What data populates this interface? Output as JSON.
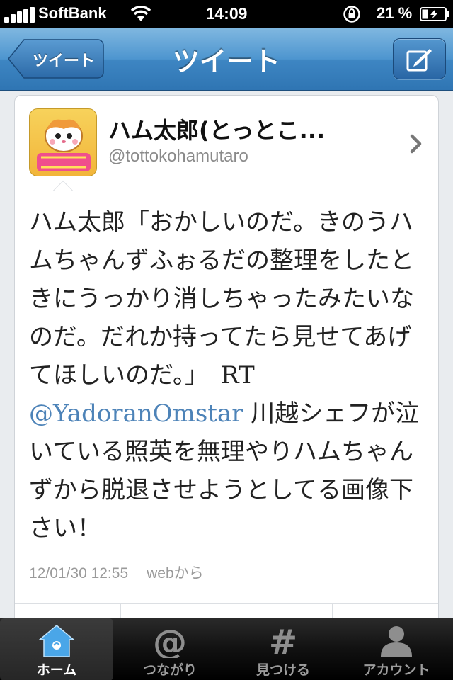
{
  "status_bar": {
    "carrier": "SoftBank",
    "time": "14:09",
    "battery_percent": "21 %"
  },
  "nav": {
    "back_label": "ツイート",
    "title": "ツイート",
    "compose_icon": "compose-icon"
  },
  "tweet": {
    "display_name": "ハム太郎(とっとこ...",
    "username": "@tottokohamutaro",
    "text_part1": "ハム太郎「おかしいのだ。きのうハムちゃんずふぉるだの整理をしたときにうっかり消しちゃったみたいなのだ。だれか持ってたら見せてあげてほしいのだ。」　",
    "rt": "RT",
    "mention": "@YadoranOmstar",
    "text_part2": " 川越シェフが泣いている照英を無理やりハムちゃんずから脱退させようとしてる画像下さい！",
    "timestamp": "12/01/30 12:55",
    "source": "webから"
  },
  "tab_bar": {
    "tabs": [
      {
        "label": "ホーム",
        "icon": "home-icon",
        "active": true
      },
      {
        "label": "つながり",
        "icon": "at-icon",
        "active": false
      },
      {
        "label": "見つける",
        "icon": "hash-icon",
        "active": false
      },
      {
        "label": "アカウント",
        "icon": "person-icon",
        "active": false
      }
    ]
  },
  "colors": {
    "nav_blue": "#3e86c3",
    "mention_blue": "#4d83b8",
    "home_icon_blue": "#4aa6e8"
  }
}
